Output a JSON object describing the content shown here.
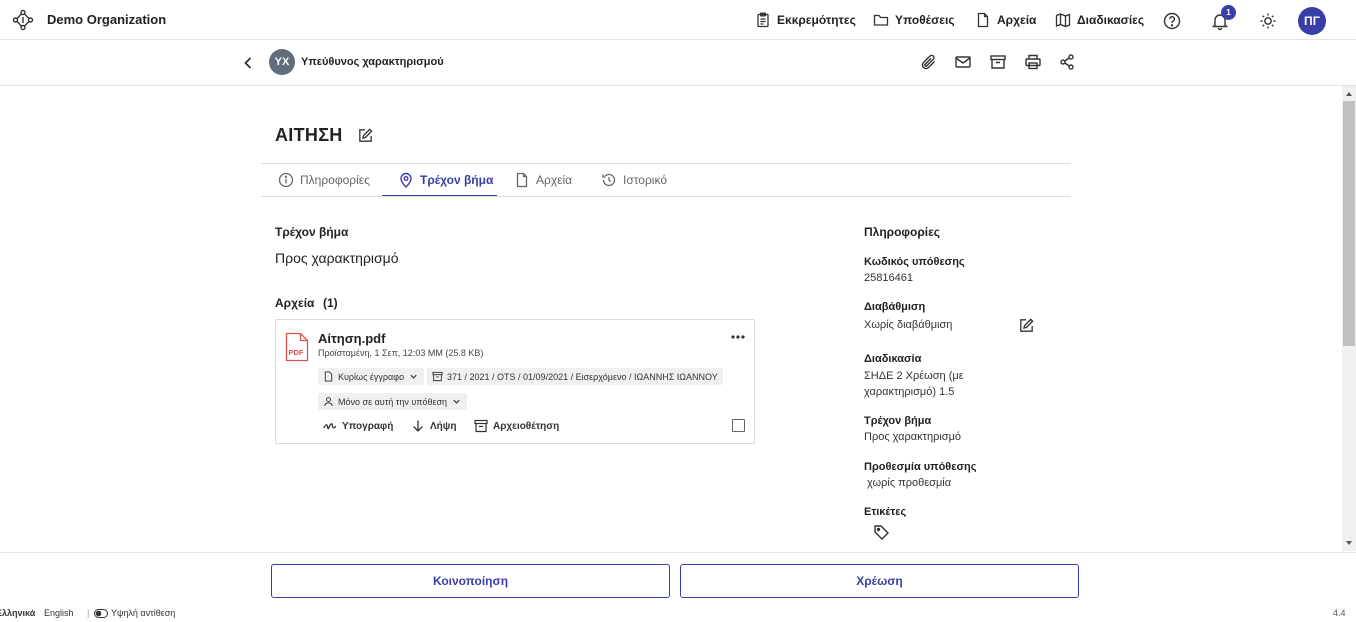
{
  "header": {
    "org_name": "Demo Organization",
    "nav": [
      {
        "label": "Εκκρεμότητες",
        "icon": "clipboard-icon"
      },
      {
        "label": "Υποθέσεις",
        "icon": "folder-icon"
      },
      {
        "label": "Αρχεία",
        "icon": "file-icon"
      },
      {
        "label": "Διαδικασίες",
        "icon": "map-icon"
      }
    ],
    "notification_count": "1",
    "user_initials": "ΠΓ"
  },
  "subbar": {
    "role_initials": "ΥΧ",
    "role_name": "Υπεύθυνος χαρακτηρισμού"
  },
  "main": {
    "title": "ΑΙΤΗΣΗ",
    "tabs": [
      {
        "label": "Πληροφορίες",
        "icon": "info-icon"
      },
      {
        "label": "Τρέχον βήμα",
        "icon": "location-pin-icon",
        "active": true
      },
      {
        "label": "Αρχεία",
        "icon": "file-icon"
      },
      {
        "label": "Ιστορικό",
        "icon": "history-icon"
      }
    ],
    "current_step_label": "Τρέχον βήμα",
    "current_step_value": "Προς χαρακτηρισμό",
    "files_label": "Αρχεία",
    "files_count": "(1)",
    "file": {
      "name": "Αίτηση.pdf",
      "meta": "Προϊσταμένη, 1 Σεπ, 12:03 ΜΜ (25.8 KB)",
      "doc_type": "Κυρίως έγγραφο",
      "protocol": "371 / 2021 / OTS / 01/09/2021 / Εισερχόμενο / ΙΩΑΝΝΗΣ ΙΩΑΝΝΟΥ",
      "scope": "Μόνο σε αυτή την υπόθεση",
      "actions": {
        "sign": "Υπογραφή",
        "download": "Λήψη",
        "archive": "Αρχειοθέτηση"
      }
    }
  },
  "info": {
    "heading": "Πληροφορίες",
    "case_code_label": "Κωδικός υπόθεσης",
    "case_code": "25816461",
    "grading_label": "Διαβάθμιση",
    "grading": "Χωρίς διαβάθμιση",
    "procedure_label": "Διαδικασία",
    "procedure": "ΣΗΔΕ 2 Χρέωση (με χαρακτηρισμό) 1.5",
    "step_label": "Τρέχον βήμα",
    "step": "Προς χαρακτηρισμό",
    "deadline_label": "Προθεσμία υπόθεσης",
    "deadline": " χωρίς προθεσμία",
    "tags_label": "Ετικέτες"
  },
  "actions": {
    "share": "Κοινοποίηση",
    "assign": "Χρέωση"
  },
  "footer": {
    "lang_el": "Ελληνικά",
    "lang_en": "English",
    "separator": "|",
    "contrast": "Υψηλή αντίθεση",
    "version": "4.4"
  }
}
